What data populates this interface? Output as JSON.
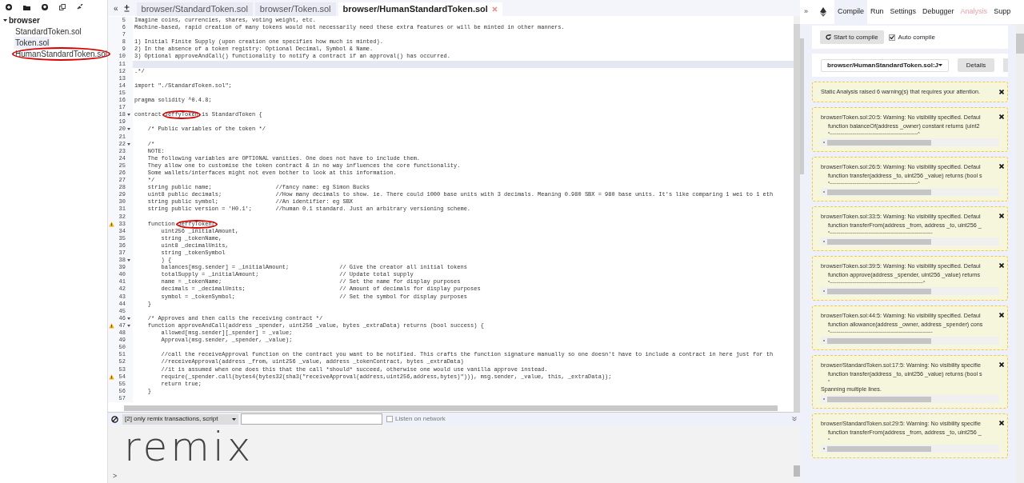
{
  "file_explorer": {
    "folder": "browser",
    "expanded": true,
    "files": [
      {
        "name": "StandardToken.sol",
        "selected": false,
        "circled": false
      },
      {
        "name": "Token.sol",
        "selected": true,
        "circled": false
      },
      {
        "name": "HumanStandardToken.sol",
        "selected": false,
        "circled": true
      }
    ]
  },
  "editor": {
    "collapse_button": "«",
    "tabs": [
      {
        "label": "browser/StandardToken.sol",
        "selected": false
      },
      {
        "label": "browser/Token.sol",
        "selected": false
      },
      {
        "label": "browser/HumanStandardToken.sol",
        "selected": true
      }
    ],
    "lines": [
      {
        "n": "5",
        "text": "Imagine coins, currencies, shares, voting weight, etc.",
        "warning": false,
        "fold": false,
        "current": false
      },
      {
        "n": "6",
        "text": "Machine-based, rapid creation of many tokens would not necessarily need these extra features or will be minted in other manners.",
        "warning": false,
        "fold": false,
        "current": false
      },
      {
        "n": "7",
        "warning": false,
        "fold": false,
        "current": false
      },
      {
        "n": "8",
        "text": "1) Initial Finite Supply (upon creation one specifies how much is minted).",
        "warning": false,
        "fold": false,
        "current": false
      },
      {
        "n": "9",
        "text": "2) In the absence of a token registry: Optional Decimal, Symbol & Name.",
        "warning": false,
        "fold": false,
        "current": false
      },
      {
        "n": "10",
        "text": "3) Optional approveAndCall() functionality to notify a contract if an approval() has occurred.",
        "warning": false,
        "fold": false,
        "current": false
      },
      {
        "n": "11",
        "warning": false,
        "fold": false,
        "current": true
      },
      {
        "n": "12",
        "text": ".*/",
        "warning": false,
        "fold": false,
        "current": false
      },
      {
        "n": "13",
        "warning": false,
        "fold": false,
        "current": false
      },
      {
        "n": "14",
        "text": "import \"./StandardToken.sol\";",
        "warning": false,
        "fold": false,
        "current": false
      },
      {
        "n": "15",
        "warning": false,
        "fold": false,
        "current": false
      },
      {
        "n": "16",
        "text": "pragma solidity ^0.4.8;",
        "warning": false,
        "fold": false,
        "current": false
      },
      {
        "n": "17",
        "warning": false,
        "fold": false,
        "current": false
      },
      {
        "n": "18",
        "parts": [
          {
            "text": "contract ",
            "circled": false
          },
          {
            "text": "JeffyToken",
            "circled": true
          },
          {
            "text": " is StandardToken {",
            "circled": false
          }
        ],
        "warning": false,
        "fold": true,
        "current": false
      },
      {
        "n": "19",
        "warning": false,
        "fold": false,
        "current": false
      },
      {
        "n": "20",
        "text": "    /* Public variables of the token */",
        "warning": false,
        "fold": true,
        "current": false
      },
      {
        "n": "21",
        "warning": false,
        "fold": false,
        "current": false
      },
      {
        "n": "22",
        "text": "    /*",
        "warning": false,
        "fold": true,
        "current": false
      },
      {
        "n": "23",
        "text": "    NOTE:",
        "warning": false,
        "fold": false,
        "current": false
      },
      {
        "n": "24",
        "text": "    The following variables are OPTIONAL vanities. One does not have to include them.",
        "warning": false,
        "fold": false,
        "current": false
      },
      {
        "n": "25",
        "text": "    They allow one to customise the token contract & in no way influences the core functionality.",
        "warning": false,
        "fold": false,
        "current": false
      },
      {
        "n": "26",
        "text": "    Some wallets/interfaces might not even bother to look at this information.",
        "warning": false,
        "fold": false,
        "current": false
      },
      {
        "n": "27",
        "text": "    */",
        "warning": false,
        "fold": false,
        "current": false
      },
      {
        "n": "28",
        "text": "    string public name;                   //fancy name: eg Simon Bucks",
        "warning": false,
        "fold": false,
        "current": false
      },
      {
        "n": "29",
        "text": "    uint8 public decimals;                //How many decimals to show. ie. There could 1000 base units with 3 decimals. Meaning 0.980 SBX = 980 base units. It's like comparing 1 wei to 1 eth",
        "warning": false,
        "fold": false,
        "current": false
      },
      {
        "n": "30",
        "text": "    string public symbol;                 //An identifier: eg SBX",
        "warning": false,
        "fold": false,
        "current": false
      },
      {
        "n": "31",
        "text": "    string public version = 'H0.1';       //human 0.1 standard. Just an arbitrary versioning scheme.",
        "warning": false,
        "fold": false,
        "current": false
      },
      {
        "n": "32",
        "warning": false,
        "fold": false,
        "current": false
      },
      {
        "n": "33",
        "parts": [
          {
            "text": "    function ",
            "circled": false
          },
          {
            "text": "JeffyToken(",
            "circled": true
          }
        ],
        "warning": true,
        "fold": false,
        "current": false
      },
      {
        "n": "34",
        "text": "        uint256 _initialAmount,",
        "warning": false,
        "fold": false,
        "current": false
      },
      {
        "n": "35",
        "text": "        string _tokenName,",
        "warning": false,
        "fold": false,
        "current": false
      },
      {
        "n": "36",
        "text": "        uint8 _decimalUnits,",
        "warning": false,
        "fold": false,
        "current": false
      },
      {
        "n": "37",
        "text": "        string _tokenSymbol",
        "warning": false,
        "fold": false,
        "current": false
      },
      {
        "n": "38",
        "text": "        ) {",
        "warning": false,
        "fold": true,
        "current": false
      },
      {
        "n": "39",
        "text": "        balances[msg.sender] = _initialAmount;               // Give the creator all initial tokens",
        "warning": false,
        "fold": false,
        "current": false
      },
      {
        "n": "40",
        "text": "        totalSupply = _initialAmount;                        // Update total supply",
        "warning": false,
        "fold": false,
        "current": false
      },
      {
        "n": "41",
        "text": "        name = _tokenName;                                   // Set the name for display purposes",
        "warning": false,
        "fold": false,
        "current": false
      },
      {
        "n": "42",
        "text": "        decimals = _decimalUnits;                            // Amount of decimals for display purposes",
        "warning": false,
        "fold": false,
        "current": false
      },
      {
        "n": "43",
        "text": "        symbol = _tokenSymbol;                               // Set the symbol for display purposes",
        "warning": false,
        "fold": false,
        "current": false
      },
      {
        "n": "44",
        "text": "    }",
        "warning": false,
        "fold": false,
        "current": false
      },
      {
        "n": "45",
        "warning": false,
        "fold": false,
        "current": false
      },
      {
        "n": "46",
        "text": "    /* Approves and then calls the receiving contract */",
        "warning": false,
        "fold": true,
        "current": false
      },
      {
        "n": "47",
        "text": "    function approveAndCall(address _spender, uint256 _value, bytes _extraData) returns (bool success) {",
        "warning": true,
        "fold": true,
        "current": false
      },
      {
        "n": "48",
        "text": "        allowed[msg.sender][_spender] = _value;",
        "warning": false,
        "fold": false,
        "current": false
      },
      {
        "n": "49",
        "text": "        Approval(msg.sender, _spender, _value);",
        "warning": false,
        "fold": false,
        "current": false
      },
      {
        "n": "50",
        "warning": false,
        "fold": false,
        "current": false
      },
      {
        "n": "51",
        "text": "        //call the receiveApproval function on the contract you want to be notified. This crafts the function signature manually so one doesn't have to include a contract in here just for th",
        "warning": false,
        "fold": false,
        "current": false
      },
      {
        "n": "52",
        "text": "        //receiveApproval(address _from, uint256 _value, address _tokenContract, bytes _extraData)",
        "warning": false,
        "fold": false,
        "current": false
      },
      {
        "n": "53",
        "text": "        //it is assumed when one does this that the call *should* succeed, otherwise one would use vanilla approve instead.",
        "warning": false,
        "fold": false,
        "current": false
      },
      {
        "n": "54",
        "text": "        require(_spender.call(bytes4(bytes32(sha3(\"receiveApproval(address,uint256,address,bytes)\"))), msg.sender, _value, this, _extraData));",
        "warning": true,
        "fold": false,
        "current": false
      },
      {
        "n": "55",
        "text": "        return true;",
        "warning": false,
        "fold": false,
        "current": false
      },
      {
        "n": "56",
        "text": "    }",
        "warning": false,
        "fold": false,
        "current": false
      },
      {
        "n": "57",
        "warning": false,
        "fold": false,
        "current": false
      }
    ]
  },
  "terminal": {
    "filter": "[2] only remix transactions, script",
    "listen": {
      "label": "Listen on network",
      "checked": false
    },
    "logo": "remix",
    "prompt": ">"
  },
  "right_panel": {
    "expand_button": "»",
    "tabs": [
      {
        "label": "Compile",
        "selected": true,
        "alert": false
      },
      {
        "label": "Run",
        "selected": false,
        "alert": false
      },
      {
        "label": "Settings",
        "selected": false,
        "alert": false
      },
      {
        "label": "Debugger",
        "selected": false,
        "alert": false
      },
      {
        "label": "Analysis",
        "selected": false,
        "alert": true
      },
      {
        "label": "Supp",
        "selected": false,
        "alert": false
      }
    ],
    "compile_button": "Start to compile",
    "auto_compile": {
      "label": "Auto compile",
      "checked": true
    },
    "contract_select": "browser/HumanStandardToken.sol:J",
    "details_button": "Details",
    "summary": "Static Analysis raised 6 warning(s) that requires your attention.",
    "warnings": [
      {
        "header": "browser/Token.sol:20:5: Warning: No visibility specified. Defaul",
        "code": "function balanceOf(address _owner) constant returns (uint2",
        "caret": "^------------------------------------------------------------------^"
      },
      {
        "header": "browser/Token.sol:26:5: Warning: No visibility specified. Defaul",
        "code": "function transfer(address _to, uint256 _value) returns (bool s",
        "caret": "^------------------------------------------------------------------^"
      },
      {
        "header": "browser/Token.sol:33:5: Warning: No visibility specified. Defaul",
        "code": "function transferFrom(address _from, address _to, uint256 _",
        "caret": "^-----------------------------------------------------------------------------"
      },
      {
        "header": "browser/Token.sol:39:5: Warning: No visibility specified. Defaul",
        "code": "function approve(address _spender, uint256 _value) returns",
        "caret": "^----------------------------------------------------------------------^"
      },
      {
        "header": "browser/Token.sol:44:5: Warning: No visibility specified. Defaul",
        "code": "function allowance(address _owner, address _spender) cons",
        "caret": "^-----------------------------------------------------------------------------"
      },
      {
        "header": "browser/StandardToken.sol:17:5: Warning: No visibility specifie",
        "code": "function transfer(address _to, uint256 _value) returns (bool s",
        "caret": "^",
        "note": "Spanning multiple lines."
      },
      {
        "header": "browser/StandardToken.sol:29:5: Warning: No visibility specifie",
        "code": "function transferFrom(address _from, address _to, uint256 _",
        "caret": "^"
      }
    ]
  }
}
